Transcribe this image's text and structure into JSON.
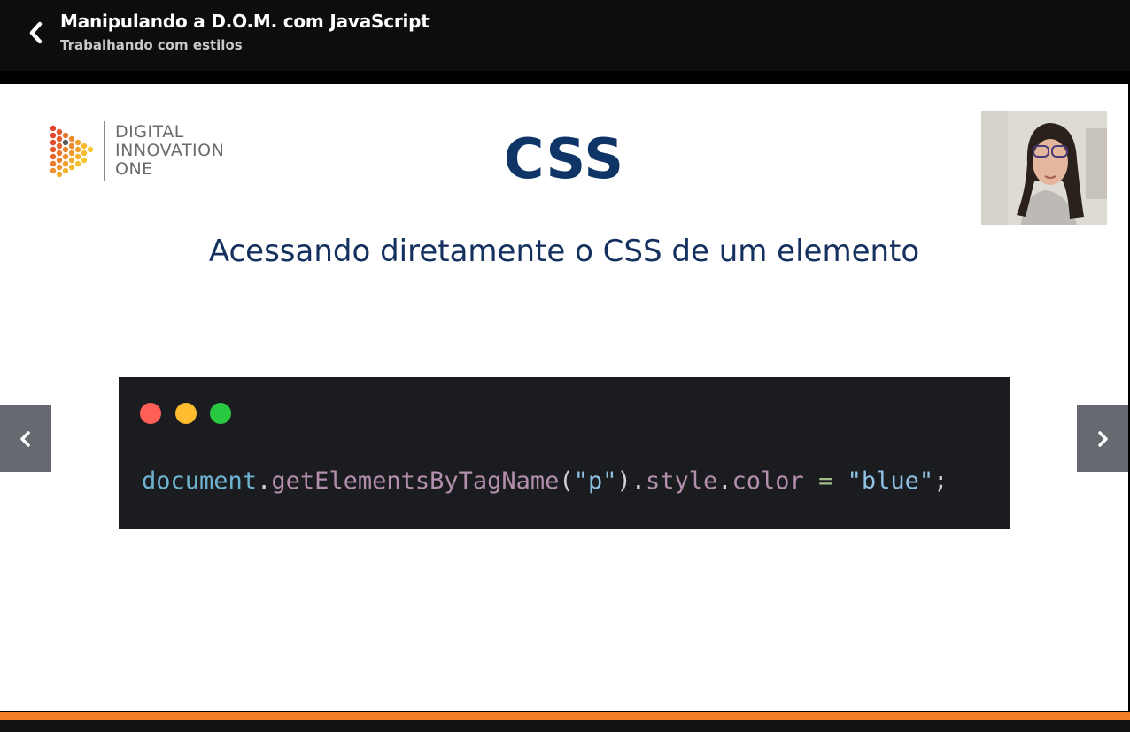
{
  "header": {
    "course_title": "Manipulando a D.O.M. com JavaScript",
    "lesson_title": "Trabalhando com estilos",
    "back_icon": "chevron-left-icon"
  },
  "slide": {
    "logo": {
      "line1": "DIGITAL",
      "line2": "INNOVATION",
      "line3": "ONE"
    },
    "title": "CSS",
    "subtitle": "Acessando diretamente o CSS de um elemento",
    "code": {
      "window_dots": [
        "#ff5f57",
        "#febc2e",
        "#28c840"
      ],
      "tokens": [
        {
          "text": "document",
          "color": "#6fb3d2"
        },
        {
          "text": ".",
          "color": "#d0d0d0"
        },
        {
          "text": "getElementsByTagName",
          "color": "#b48ead"
        },
        {
          "text": "(",
          "color": "#d0d0d0"
        },
        {
          "text": "\"p\"",
          "color": "#8fc1e3"
        },
        {
          "text": ").",
          "color": "#d0d0d0"
        },
        {
          "text": "style",
          "color": "#b48ead"
        },
        {
          "text": ".",
          "color": "#d0d0d0"
        },
        {
          "text": "color",
          "color": "#b48ead"
        },
        {
          "text": " ",
          "color": "#d0d0d0"
        },
        {
          "text": "=",
          "color": "#a3be8c"
        },
        {
          "text": " ",
          "color": "#d0d0d0"
        },
        {
          "text": "\"blue\"",
          "color": "#8fc1e3"
        },
        {
          "text": ";",
          "color": "#d0d0d0"
        }
      ]
    }
  },
  "navigation": {
    "prev_icon": "chevron-left-icon",
    "next_icon": "chevron-right-icon"
  },
  "progress": {
    "color": "#f17f2a"
  }
}
